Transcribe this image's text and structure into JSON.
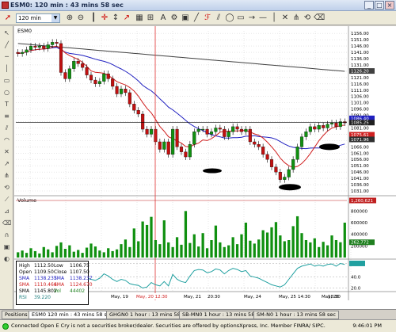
{
  "window": {
    "title": "ESM0: 120 min : 43 mins 58 sec"
  },
  "toolbar": {
    "interval": "120 min"
  },
  "chart": {
    "symbol": "ESM0",
    "volume_label": "Volume",
    "price_ticks": [
      "1156.00",
      "1151.00",
      "1146.00",
      "1141.00",
      "1136.00",
      "1131.00",
      "1126.00",
      "1121.00",
      "1116.00",
      "1111.00",
      "1106.00",
      "1101.00",
      "1096.00",
      "1091.00",
      "1086.00",
      "1081.00",
      "1076.00",
      "1071.00",
      "1066.00",
      "1061.00",
      "1056.00",
      "1051.00",
      "1046.00",
      "1041.00",
      "1036.00",
      "1031.00"
    ],
    "price_badges": [
      {
        "text": "1126.20",
        "color": "#404040",
        "price": 1126.2
      },
      {
        "text": "1086.40",
        "color": "#2020c0",
        "price": 1088.6
      },
      {
        "text": "1085.25",
        "color": "#202020",
        "price": 1085.25
      },
      {
        "text": "1075.61",
        "color": "#d02020",
        "price": 1075.6
      },
      {
        "text": "1071.96",
        "color": "#303030",
        "price": 1071.9
      }
    ],
    "volume_ticks": [
      "800000",
      "600000",
      "400000",
      "200000"
    ],
    "volume_badges": [
      {
        "text": "1,260,621",
        "color": "#c02020"
      },
      {
        "text": "262,772",
        "color": "#208020"
      }
    ],
    "rsi_ticks": [
      "65.0",
      "40.0",
      "20.0"
    ],
    "date_labels": [
      "May, 19",
      "May, 20 12:30",
      "May, 21",
      "20:30",
      "May, 24",
      "May, 25",
      "14:30",
      "May, 26",
      "18:30"
    ]
  },
  "chart_data": {
    "type": "candlestick",
    "price_ylim": [
      1031,
      1158
    ],
    "closes": [
      1140,
      1141,
      1143,
      1146,
      1145,
      1146,
      1144,
      1147,
      1149,
      1148,
      1125,
      1120,
      1128,
      1134,
      1132,
      1129,
      1123,
      1119,
      1116,
      1118,
      1124,
      1120,
      1114,
      1108,
      1112,
      1109,
      1100,
      1095,
      1092,
      1080,
      1076,
      1080,
      1070,
      1064,
      1070,
      1060,
      1080,
      1066,
      1062,
      1058,
      1068,
      1078,
      1080,
      1080,
      1076,
      1078,
      1081,
      1080,
      1074,
      1078,
      1082,
      1080,
      1078,
      1080,
      1070,
      1068,
      1066,
      1060,
      1056,
      1050,
      1046,
      1040,
      1042,
      1048,
      1056,
      1066,
      1074,
      1078,
      1082,
      1080,
      1083,
      1081,
      1084,
      1085,
      1082,
      1086,
      1085
    ],
    "volumes": [
      90000,
      120000,
      80000,
      160000,
      110000,
      70000,
      180000,
      140000,
      90000,
      200000,
      260000,
      150000,
      210000,
      100000,
      130000,
      80000,
      170000,
      240000,
      190000,
      120000,
      90000,
      160000,
      110000,
      140000,
      230000,
      310000,
      180000,
      500000,
      280000,
      620000,
      560000,
      700000,
      300000,
      230000,
      640000,
      260000,
      180000,
      350000,
      220000,
      800000,
      250000,
      400000,
      190000,
      420000,
      160000,
      300000,
      550000,
      260000,
      180000,
      210000,
      350000,
      230000,
      400000,
      600000,
      290000,
      240000,
      310000,
      470000,
      430000,
      520000,
      610000,
      380000,
      280000,
      300000,
      540000,
      710000,
      420000,
      300000,
      260000,
      330000,
      180000,
      270000,
      210000,
      380000,
      300000,
      262772,
      600000
    ],
    "rsi": [
      52,
      54,
      58,
      60,
      56,
      58,
      55,
      60,
      62,
      58,
      40,
      35,
      45,
      50,
      48,
      44,
      38,
      36,
      34,
      38,
      46,
      42,
      36,
      32,
      36,
      34,
      28,
      26,
      25,
      20,
      22,
      30,
      26,
      24,
      32,
      24,
      45,
      36,
      32,
      30,
      42,
      52,
      54,
      53,
      48,
      50,
      55,
      53,
      46,
      52,
      56,
      54,
      50,
      52,
      42,
      40,
      38,
      34,
      30,
      26,
      24,
      22,
      26,
      36,
      46,
      56,
      60,
      62,
      64,
      60,
      62,
      60,
      63,
      64,
      60,
      65,
      63
    ],
    "sma_labels": [
      "SMA 1138.237",
      "SMA 1110.464",
      "SMA 1145.802"
    ]
  },
  "infobox": {
    "high_k": "High",
    "high_v": "1112.50",
    "low_k": "Low",
    "low_v": "1106.75",
    "open_k": "Open",
    "open_v": "1109.50",
    "close_k": "Close",
    "close_v": "1107.50",
    "sma1_k": "SMA",
    "sma1_v": "1138.237",
    "sma1b_k": "SMA",
    "sma1b_v": "1138.237",
    "sma2_k": "SMA",
    "sma2_v": "1110.464",
    "sma2b_k": "SMA",
    "sma2b_v": "1124.670",
    "sma3_k": "SMA",
    "sma3_v": "1145.802",
    "vol_k": "Vol",
    "vol_v": "44402",
    "rsi_k": "RSI",
    "rsi_v": "39.220"
  },
  "tabs": [
    "Positions",
    "ESM0 120 min : 43 mins 58 sec",
    "GHGN0 1 hour : 13 mins 58 sec",
    "SB-MN0 1 hour : 13 mins 58 sec",
    "SM-N0 1 hour : 13 mins 58 sec"
  ],
  "status": {
    "text": "Connected   Open E Cry is not a securities broker/dealer. Securities are offered by optionsXpress, Inc. Member FINRA/ SIPC.",
    "clock": "9:46:01 PM"
  }
}
